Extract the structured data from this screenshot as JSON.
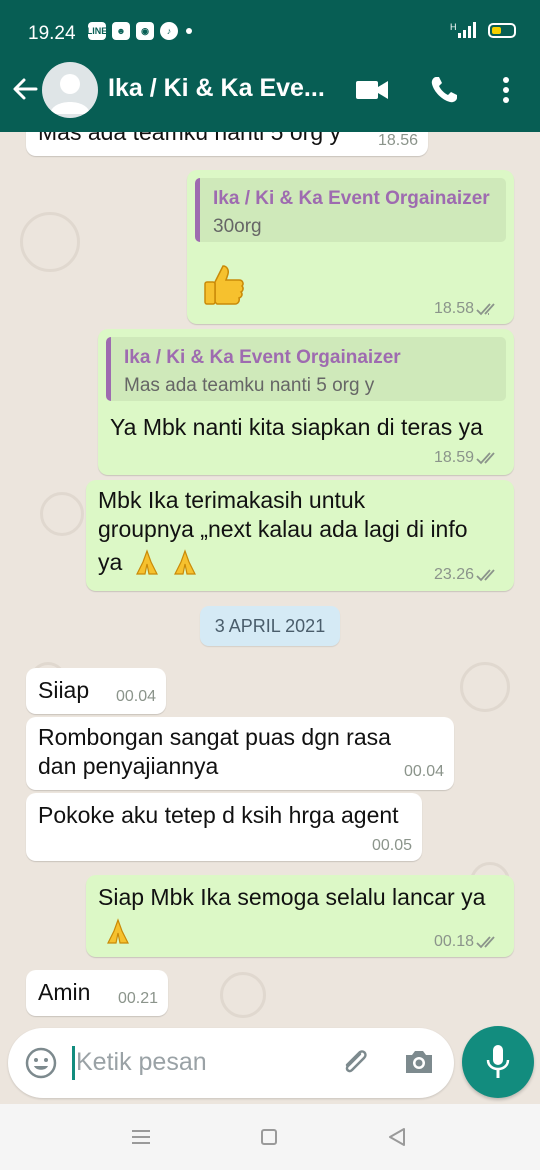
{
  "status_bar": {
    "time": "19.24",
    "icons": [
      "line-app-icon",
      "notification-icon",
      "browser-icon",
      "tiktok-icon"
    ],
    "network": "H",
    "battery_color": "#f5d000"
  },
  "header": {
    "title": "Ika / Ki & Ka Eve...",
    "accent": "#075e54"
  },
  "messages": [
    {
      "direction": "in",
      "text": "Mas ada teamku nanti 5 org y",
      "time": "18.56"
    },
    {
      "direction": "out",
      "quote_author": "Ika / Ki & Ka Event Orgainaizer",
      "quote_text": "30org",
      "emoji": "thumbs-up",
      "time": "18.58"
    },
    {
      "direction": "out",
      "quote_author": "Ika / Ki & Ka Event Orgainaizer",
      "quote_text": "Mas ada teamku nanti 5 org y",
      "text": "Ya Mbk nanti kita siapkan di teras ya",
      "time": "18.59"
    },
    {
      "direction": "out",
      "line1": "Mbk Ika terimakasih untuk",
      "line2": "groupnya „next kalau ada lagi di info",
      "line3": "ya",
      "emoji": "folded-hands",
      "time": "23.26"
    },
    {
      "direction": "in",
      "text": "Siiap",
      "time": "00.04"
    },
    {
      "direction": "in",
      "line1": "Rombongan sangat puas dgn rasa",
      "line2": "dan penyajiannya",
      "time": "00.04"
    },
    {
      "direction": "in",
      "text": "Pokoke aku tetep d ksih hrga agent",
      "time": "00.05"
    },
    {
      "direction": "out",
      "text": "Siap Mbk Ika semoga selalu lancar ya",
      "emoji": "folded-hands",
      "time": "00.18"
    },
    {
      "direction": "in",
      "text": "Amin",
      "time": "00.21"
    }
  ],
  "date_separator": "3 APRIL 2021",
  "composer": {
    "placeholder": "Ketik pesan"
  },
  "colors": {
    "incoming_bubble": "#ffffff",
    "outgoing_bubble": "#dcf8c6",
    "quote_accent": "#9e6bb0",
    "fab": "#128c7e",
    "read_ticks": "#8b948b"
  }
}
